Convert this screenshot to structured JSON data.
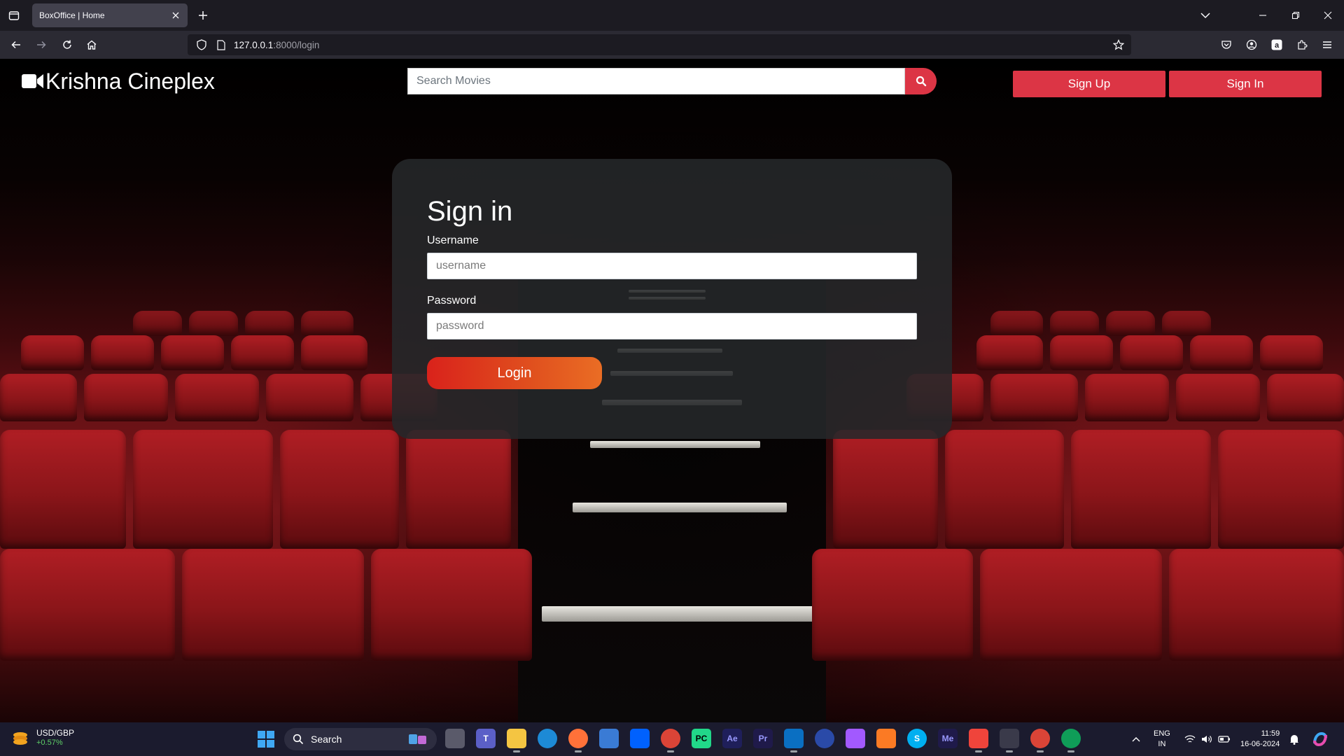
{
  "browser": {
    "tab_title": "BoxOffice | Home",
    "url_host": "127.0.0.1",
    "url_path": ":8000/login"
  },
  "site": {
    "brand": "Krishna Cineplex",
    "search_placeholder": "Search Movies",
    "signup_label": "Sign Up",
    "signin_label": "Sign In",
    "accent": "#dc3545"
  },
  "form": {
    "title": "Sign in",
    "username_label": "Username",
    "username_placeholder": "username",
    "password_label": "Password",
    "password_placeholder": "password",
    "login_label": "Login"
  },
  "taskbar": {
    "widget_name": "USD/GBP",
    "widget_value": "+0.57%",
    "search_label": "Search",
    "lang_line1": "ENG",
    "lang_line2": "IN",
    "time": "11:59",
    "date": "16-06-2024",
    "apps": [
      "file-explorer-icon",
      "teams-icon",
      "folder-icon",
      "edge-icon",
      "firefox-icon",
      "store-icon",
      "dropbox-icon",
      "chrome-icon",
      "pycharm-icon",
      "after-effects-icon",
      "premiere-icon",
      "vscode-icon",
      "media-player-icon",
      "figma-icon",
      "xampp-icon",
      "skype-icon",
      "media-encoder-icon",
      "anydesk-icon",
      "terminal-icon",
      "chrome-icon",
      "chrome-profile-icon"
    ]
  }
}
